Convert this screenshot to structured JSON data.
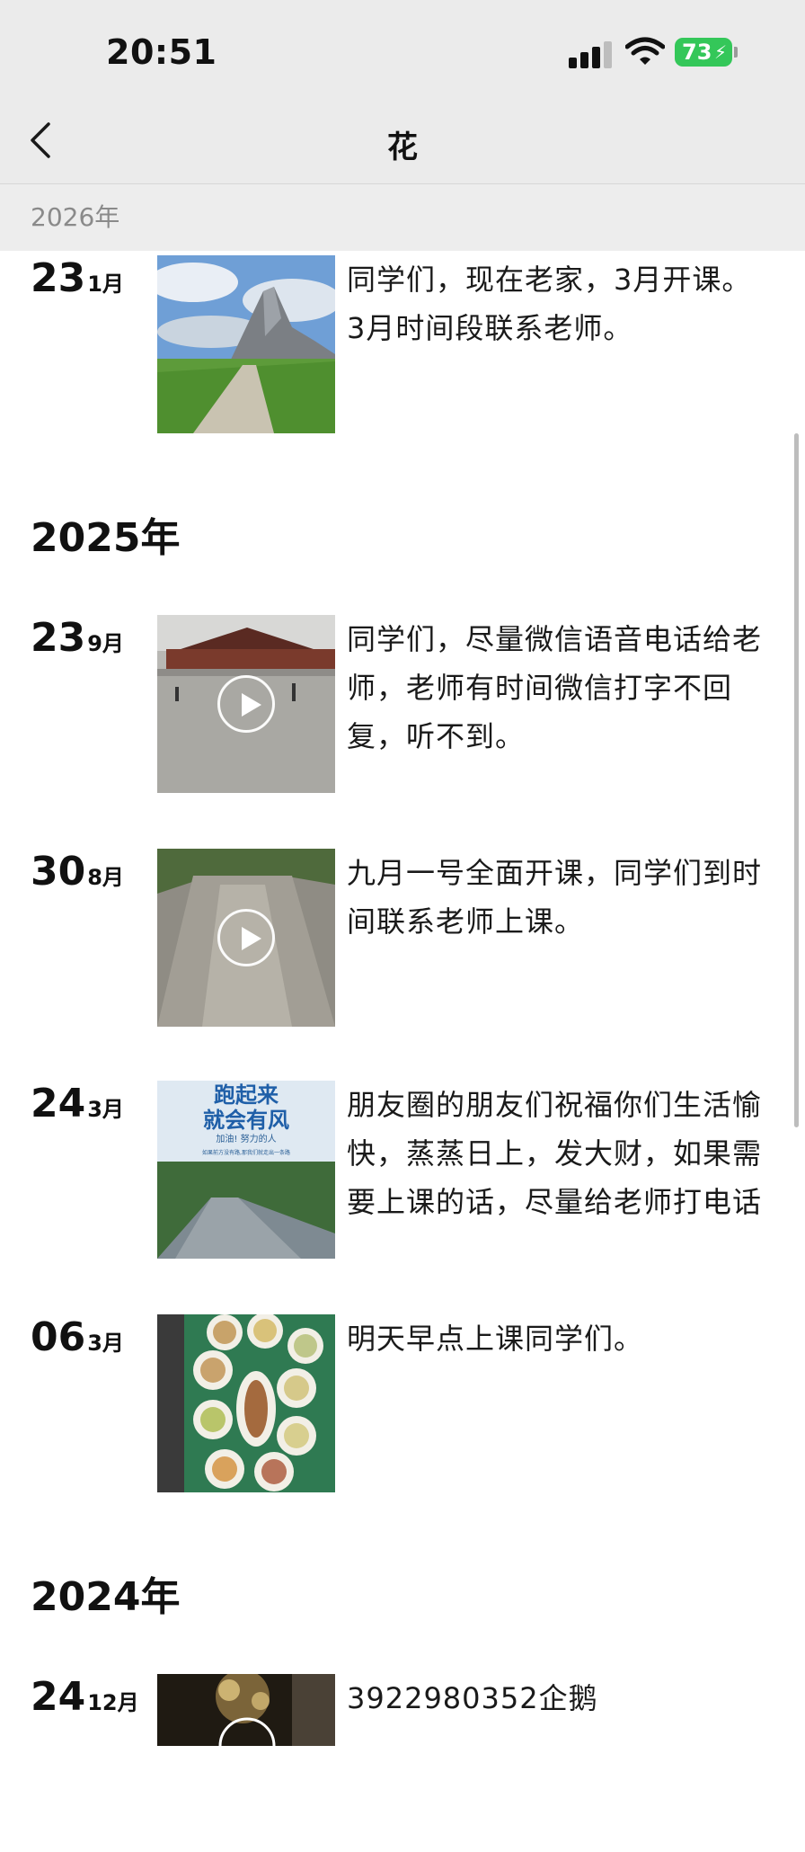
{
  "status_bar": {
    "time": "20:51",
    "battery": "73",
    "battery_color": "#34c759",
    "icons": [
      "signal-icon",
      "wifi-icon",
      "battery-icon",
      "charging-bolt-icon"
    ]
  },
  "nav": {
    "title": "花",
    "back_icon": "chevron-left-icon"
  },
  "sticky_year": "2026年",
  "sections": [
    {
      "year": "2026年",
      "posts": [
        {
          "day": "23",
          "month": "1月",
          "text": "同学们，现在老家，3月开课。3月时间段联系老师。",
          "media": "photo"
        }
      ]
    },
    {
      "year": "2025年",
      "posts": [
        {
          "day": "23",
          "month": "9月",
          "text": "同学们，尽量微信语音电话给老师，老师有时间微信打字不回复，听不到。",
          "media": "video"
        },
        {
          "day": "30",
          "month": "8月",
          "text": "九月一号全面开课，同学们到时间联系老师上课。",
          "media": "video"
        },
        {
          "day": "24",
          "month": "3月",
          "text": "朋友圈的朋友们祝福你们生活愉快，蒸蒸日上，发大财，如果需要上课的话，尽量给老师打电话",
          "media": "photo",
          "image_text": {
            "headline_1": "跑起来",
            "headline_2": "就会有风",
            "subline": "加油! 努力的人",
            "small": "如果前方没有路,那我们就走出一条路"
          }
        },
        {
          "day": "06",
          "month": "3月",
          "text": "明天早点上课同学们。",
          "media": "photo"
        }
      ]
    },
    {
      "year": "2024年",
      "posts": [
        {
          "day": "24",
          "month": "12月",
          "text": "3922980352企鹅",
          "media": "video"
        }
      ]
    }
  ]
}
